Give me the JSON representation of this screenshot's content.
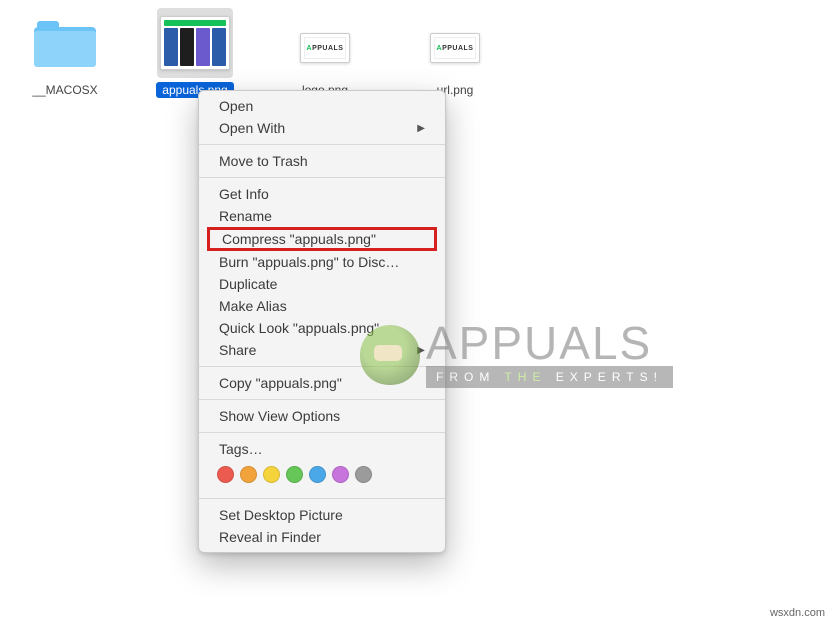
{
  "files": [
    {
      "name": "__MACOSX",
      "type": "folder",
      "selected": false
    },
    {
      "name": "appuals.png",
      "type": "image-rich",
      "selected": true
    },
    {
      "name": "logo.png",
      "type": "image-logo",
      "selected": false
    },
    {
      "name": "url.png",
      "type": "image-logo",
      "selected": false
    }
  ],
  "menu": {
    "open": "Open",
    "open_with": "Open With",
    "trash": "Move to Trash",
    "get_info": "Get Info",
    "rename": "Rename",
    "compress": "Compress \"appuals.png\"",
    "burn": "Burn \"appuals.png\" to Disc…",
    "duplicate": "Duplicate",
    "make_alias": "Make Alias",
    "quick_look": "Quick Look \"appuals.png\"",
    "share": "Share",
    "copy": "Copy \"appuals.png\"",
    "view_options": "Show View Options",
    "tags_label": "Tags…",
    "set_desktop": "Set Desktop Picture",
    "reveal": "Reveal in Finder"
  },
  "tag_colors": [
    "#ec5b4f",
    "#f2a33c",
    "#f5d33b",
    "#66c657",
    "#4aa8e8",
    "#c774dd",
    "#9b9b9b"
  ],
  "watermark": {
    "title": "APPUALS",
    "sub_left": "FROM",
    "sub_amp": "THE",
    "sub_right": "EXPERTS!"
  },
  "credit": "wsxdn.com"
}
